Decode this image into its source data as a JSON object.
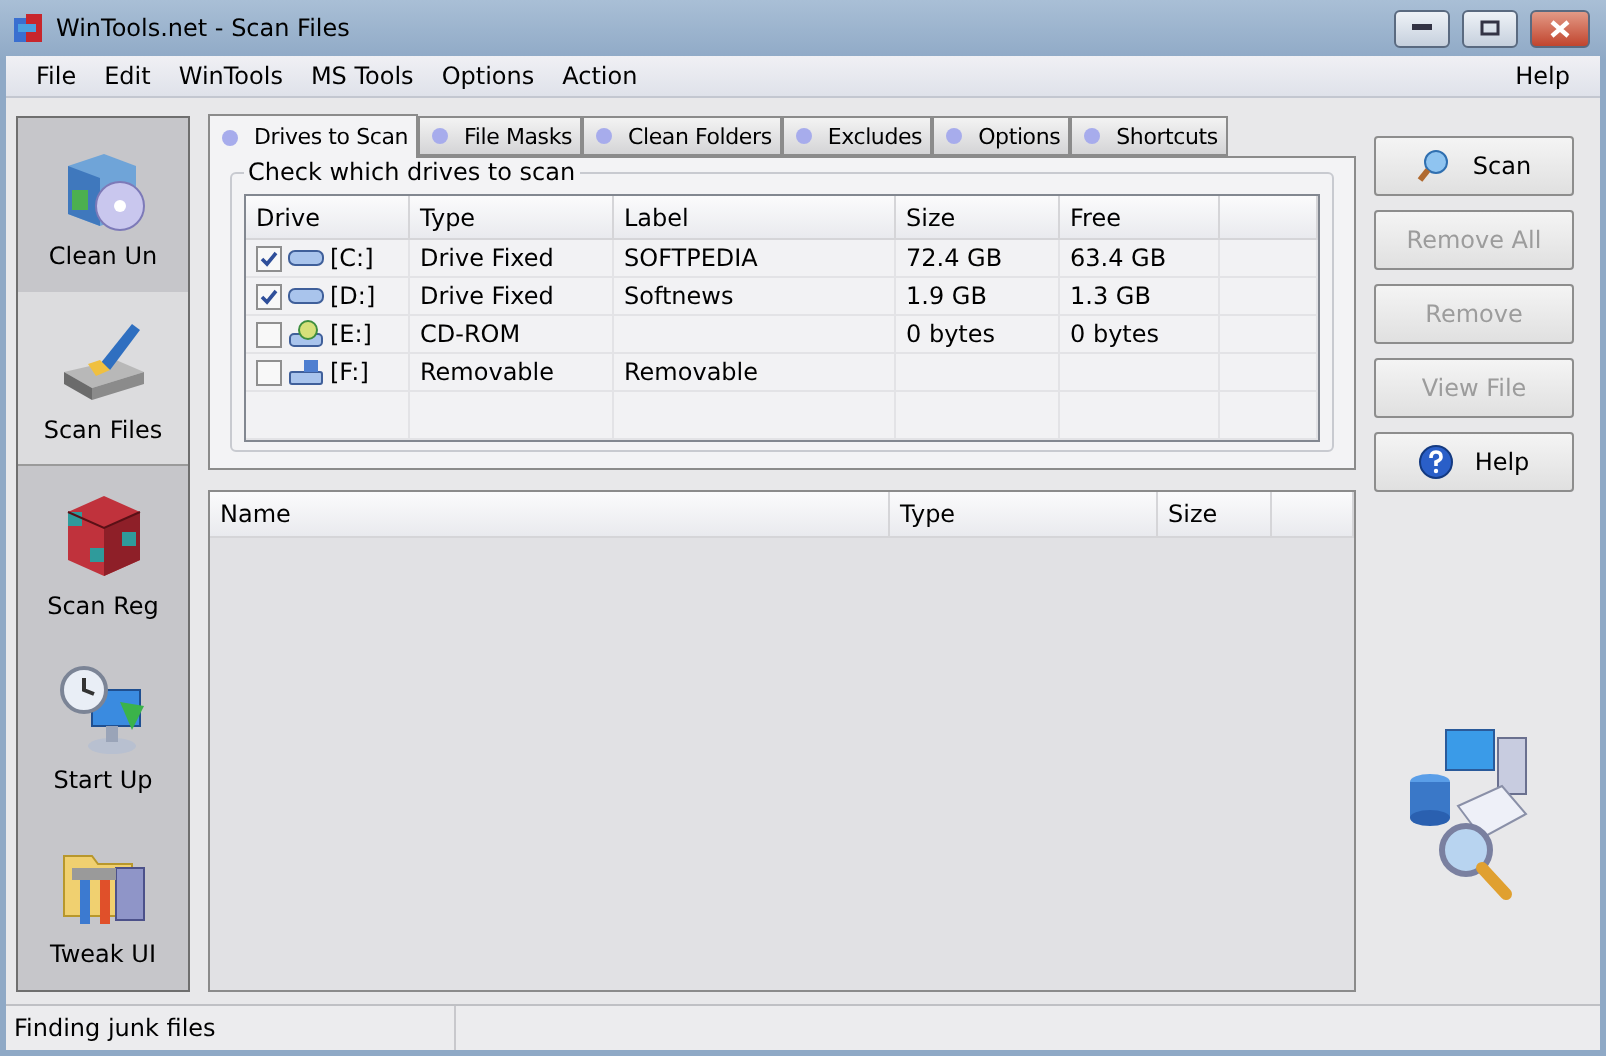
{
  "window": {
    "title": "WinTools.net - Scan Files"
  },
  "menu": {
    "items": [
      "File",
      "Edit",
      "WinTools",
      "MS Tools",
      "Options",
      "Action"
    ],
    "right": [
      "Help"
    ]
  },
  "sidebar": {
    "items": [
      {
        "label": "Clean Un",
        "kind": "package",
        "selected": false
      },
      {
        "label": "Scan Files",
        "kind": "disk",
        "selected": true
      },
      {
        "label": "Scan Reg",
        "kind": "cube",
        "selected": false
      },
      {
        "label": "Start Up",
        "kind": "clock",
        "selected": false
      },
      {
        "label": "Tweak UI",
        "kind": "tools",
        "selected": false
      }
    ]
  },
  "tabs": [
    {
      "label": "Drives to Scan",
      "selected": true
    },
    {
      "label": "File Masks",
      "selected": false
    },
    {
      "label": "Clean Folders",
      "selected": false
    },
    {
      "label": "Excludes",
      "selected": false
    },
    {
      "label": "Options",
      "selected": false
    },
    {
      "label": "Shortcuts",
      "selected": false
    }
  ],
  "drive_group": {
    "title": "Check which drives to scan",
    "columns": [
      "Drive",
      "Type",
      "Label",
      "Size",
      "Free"
    ],
    "rows": [
      {
        "drive": "[C:]",
        "kind": "fixed",
        "checked": true,
        "type": "Drive Fixed",
        "label": "SOFTPEDIA",
        "size": "72.4 GB",
        "free": "63.4 GB"
      },
      {
        "drive": "[D:]",
        "kind": "fixed",
        "checked": true,
        "type": "Drive Fixed",
        "label": "Softnews",
        "size": "1.9 GB",
        "free": "1.3 GB"
      },
      {
        "drive": "[E:]",
        "kind": "cdrom",
        "checked": false,
        "type": "CD-ROM",
        "size": "0 bytes",
        "free": "0 bytes"
      },
      {
        "drive": "[F:]",
        "kind": "removable",
        "checked": false,
        "type": "Removable",
        "label": "Removable"
      }
    ]
  },
  "file_list": {
    "columns": [
      "Name",
      "Type",
      "Size"
    ]
  },
  "buttons": [
    {
      "label": "Scan",
      "kind": "scan",
      "disabled": false
    },
    {
      "label": "Remove All",
      "kind": "plain",
      "disabled": true
    },
    {
      "label": "Remove",
      "kind": "plain",
      "disabled": true
    },
    {
      "label": "View File",
      "kind": "plain",
      "disabled": true
    },
    {
      "label": "Help",
      "kind": "help",
      "disabled": false
    }
  ],
  "status_bar": {
    "text": "Finding junk files"
  }
}
